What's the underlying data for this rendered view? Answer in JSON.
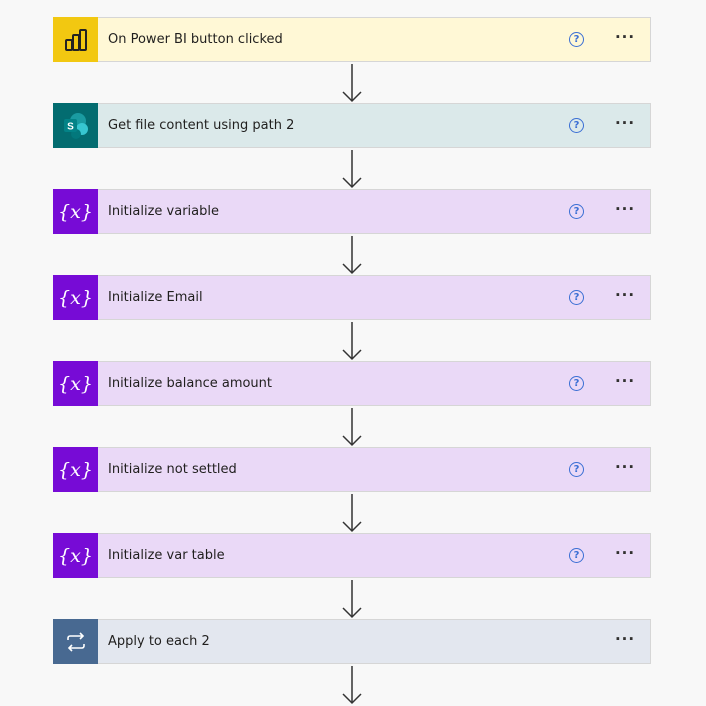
{
  "flow": {
    "steps": [
      {
        "label": "On Power BI button clicked",
        "icon": "power-bi-icon",
        "help": "?",
        "more": "···",
        "color": "#fff8d6",
        "icon_color": "#f2c811"
      },
      {
        "label": "Get file content using path 2",
        "icon": "sharepoint-icon",
        "icon_text": "S",
        "help": "?",
        "more": "···",
        "color": "#dbe9ea",
        "icon_color": "#036c70"
      },
      {
        "label": "Initialize variable",
        "icon": "variable-icon",
        "icon_text": "{x}",
        "help": "?",
        "more": "···",
        "color": "#ead9f7",
        "icon_color": "#770bd6"
      },
      {
        "label": "Initialize Email",
        "icon": "variable-icon",
        "icon_text": "{x}",
        "help": "?",
        "more": "···",
        "color": "#ead9f7",
        "icon_color": "#770bd6"
      },
      {
        "label": "Initialize balance amount",
        "icon": "variable-icon",
        "icon_text": "{x}",
        "help": "?",
        "more": "···",
        "color": "#ead9f7",
        "icon_color": "#770bd6"
      },
      {
        "label": "Initialize not settled",
        "icon": "variable-icon",
        "icon_text": "{x}",
        "help": "?",
        "more": "···",
        "color": "#ead9f7",
        "icon_color": "#770bd6"
      },
      {
        "label": "Initialize var table",
        "icon": "variable-icon",
        "icon_text": "{x}",
        "help": "?",
        "more": "···",
        "color": "#ead9f7",
        "icon_color": "#770bd6"
      },
      {
        "label": "Apply to each 2",
        "icon": "loop-icon",
        "more": "···",
        "color": "#e3e7ef",
        "icon_color": "#486991"
      }
    ]
  }
}
